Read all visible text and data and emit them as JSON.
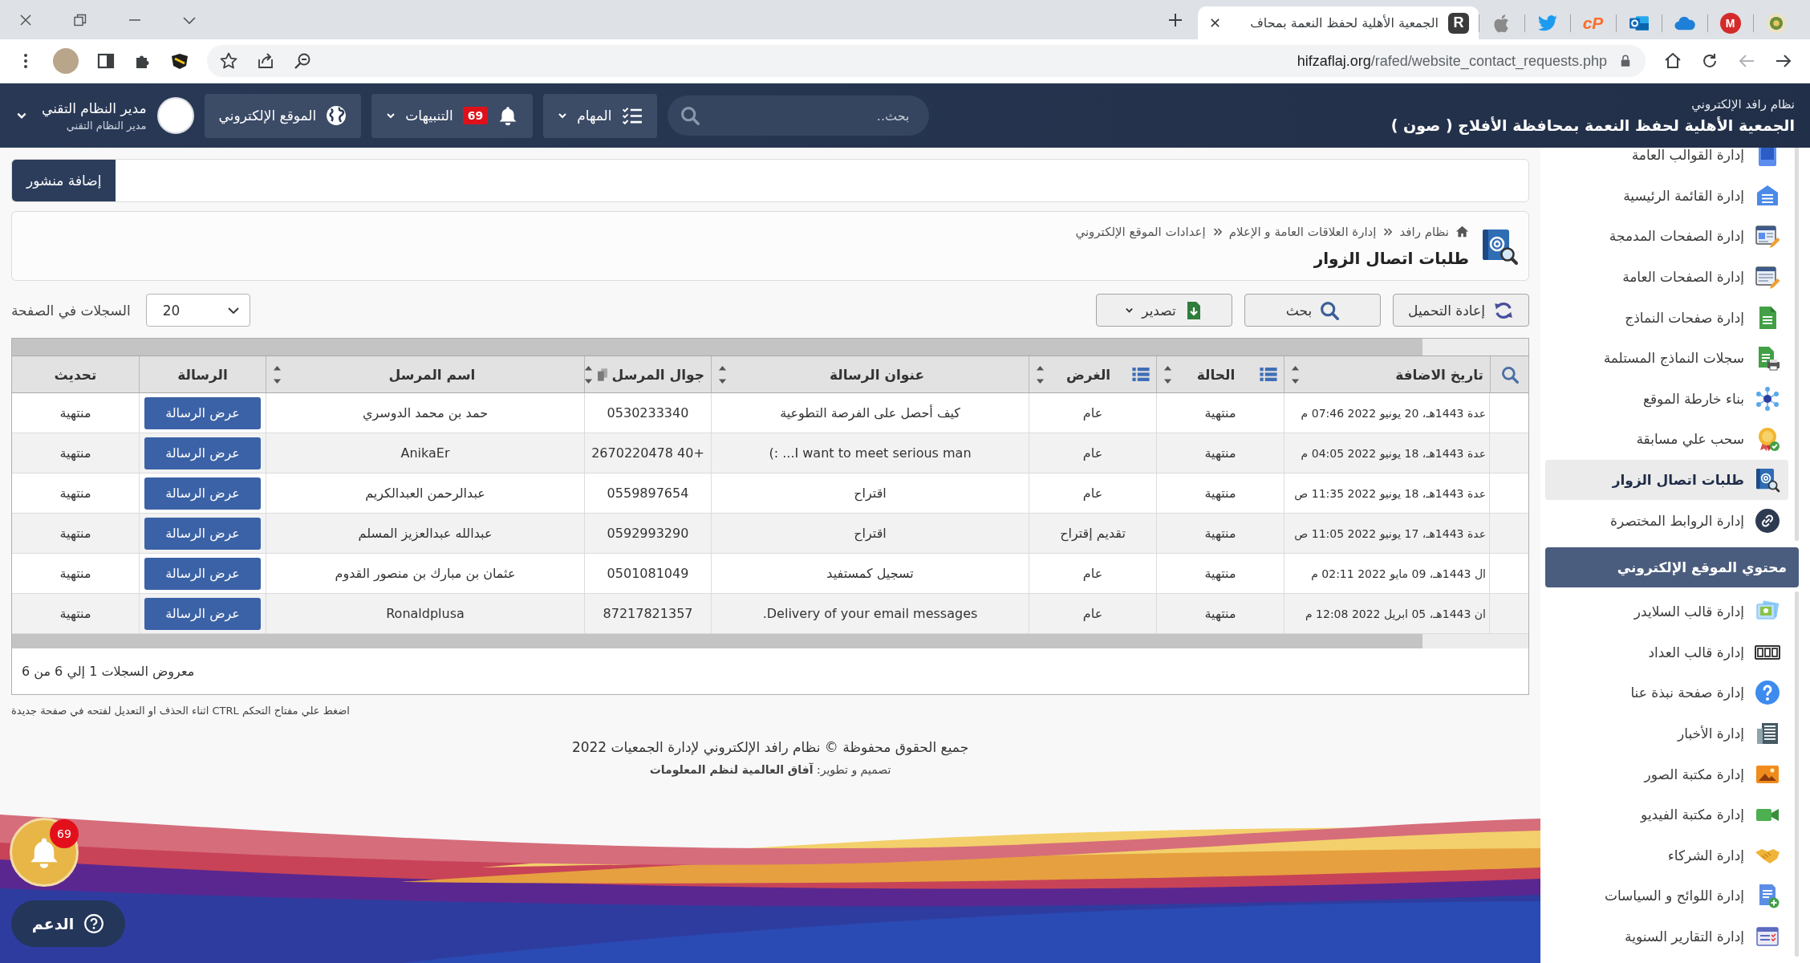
{
  "browser": {
    "tabs": [
      {
        "selected": false
      },
      {
        "selected": false,
        "text": "M"
      },
      {
        "selected": false
      },
      {
        "selected": false
      },
      {
        "selected": false,
        "text": "cP"
      },
      {
        "selected": false
      },
      {
        "selected": false
      },
      {
        "selected": true,
        "favicon": "R",
        "title": "الجمعية الأهلية لحفظ النعمة بمحاف"
      }
    ],
    "url": {
      "host": "hifzaflaj.org",
      "path": "/rafed/website_contact_requests.php"
    }
  },
  "header": {
    "system_name": "نظام رافد الإلكتروني",
    "org_name": "الجمعية الأهلية لحفظ النعمة بمحافظة الأفلاج ( صون )",
    "search": {
      "placeholder": "بحث.."
    },
    "menus": [
      {
        "kind": "tasks",
        "label": "المهام"
      },
      {
        "kind": "notifications",
        "label": "التنبيهات",
        "badge": "69"
      },
      {
        "kind": "website",
        "label": "الموقع الإلكتروني"
      }
    ],
    "user": {
      "name": "مدير النظام التقني",
      "role": "مدير النظام التقني"
    }
  },
  "sidebar": {
    "groups": [
      {
        "items": [
          {
            "label": "إدارة القوالب العامة",
            "selected": false
          },
          {
            "label": "إدارة القائمة الرئيسية",
            "selected": false
          },
          {
            "label": "إدارة الصفحات المدمجة",
            "selected": false
          },
          {
            "label": "إدارة الصفحات العامة",
            "selected": false
          },
          {
            "label": "إدارة صفحات النماذج",
            "selected": false
          },
          {
            "label": "سجلات النماذج المستلمة",
            "selected": false
          },
          {
            "label": "بناء خارطة الموقع",
            "selected": false
          },
          {
            "label": "سحب علي مسابقة",
            "selected": false
          },
          {
            "label": "طلبات اتصال الزوار",
            "selected": true
          },
          {
            "label": "إدارة الروابط المختصرة",
            "selected": false
          }
        ]
      },
      {
        "heading": "محتوي الموقع الإلكتروني",
        "items": [
          {
            "label": "إدارة قالب السلايدر",
            "selected": false
          },
          {
            "label": "إدارة قالب العداد",
            "selected": false
          },
          {
            "label": "إدارة صفحة نبذة عنا",
            "selected": false
          },
          {
            "label": "إدارة الأخبار",
            "selected": false
          },
          {
            "label": "إدارة مكتبة الصور",
            "selected": false
          },
          {
            "label": "إدارة مكتبة الفيديو",
            "selected": false
          },
          {
            "label": "إدارة الشركاء",
            "selected": false
          },
          {
            "label": "إدارة اللوائح و السياسات",
            "selected": false
          },
          {
            "label": "إدارة التقارير السنوية",
            "selected": false
          }
        ]
      }
    ]
  },
  "post_bar": {
    "button": "إضافة منشور"
  },
  "page": {
    "breadcrumb": [
      "نظام رافد",
      "إدارة العلاقات العامة و الإعلام",
      "إعدادات الموقع الإلكتروني"
    ],
    "title": "طلبات اتصال الزوار"
  },
  "actions": [
    {
      "kind": "reload",
      "label": "إعادة التحميل"
    },
    {
      "kind": "search",
      "label": "بحث"
    },
    {
      "kind": "export",
      "label": "تصدير"
    }
  ],
  "page_size": {
    "label": "السجلات في الصفحة",
    "value": "20"
  },
  "table": {
    "columns": [
      {
        "label": "تاريخ الاضافة",
        "kind": "date",
        "sortable": true,
        "filterable": false
      },
      {
        "label": "الحالة",
        "kind": "text",
        "sortable": true,
        "filterable": true
      },
      {
        "label": "الغرض",
        "kind": "text",
        "sortable": true,
        "filterable": true
      },
      {
        "label": "عنوان الرسالة",
        "kind": "text",
        "sortable": true,
        "filterable": false
      },
      {
        "label": "جوال المرسل",
        "kind": "phone",
        "sortable": true,
        "filterable": false
      },
      {
        "label": "اسم المرسل",
        "kind": "text",
        "sortable": true,
        "filterable": false
      },
      {
        "label": "الرسالة",
        "kind": "button",
        "sortable": false,
        "filterable": false
      },
      {
        "label": "تحديث",
        "kind": "text",
        "sortable": false,
        "filterable": false
      }
    ],
    "rows": [
      {
        "cells": [
          "عدة 1443هـ، 20 يونيو 2022 07:46 م",
          "منتهية",
          "عام",
          "كيف أحصل على الفرصة التطوعية",
          "0530233340",
          "حمد بن محمد الدوسري",
          "عرض الرسالة",
          "منتهية"
        ]
      },
      {
        "cells": [
          "عدة 1443هـ، 18 يونيو 2022 04:05 م",
          "منتهية",
          "عام",
          "I want to meet serious man... :)",
          "+40 2670220478",
          "AnikaEr",
          "عرض الرسالة",
          "منتهية"
        ]
      },
      {
        "cells": [
          "عدة 1443هـ، 18 يونيو 2022 11:35 ص",
          "منتهية",
          "عام",
          "اقتراح",
          "0559897654",
          "عبدالرحمن العبدالكريم",
          "عرض الرسالة",
          "منتهية"
        ]
      },
      {
        "cells": [
          "عدة 1443هـ، 17 يونيو 2022 11:05 ص",
          "منتهية",
          "تقديم إقتراح",
          "اقتراح",
          "0592993290",
          "عبدالله عبدالعزيز المسلم",
          "عرض الرسالة",
          "منتهية"
        ]
      },
      {
        "cells": [
          "ال 1443هـ، 09 مايو 2022 02:11 م",
          "منتهية",
          "عام",
          "تسجيل كمستفيد",
          "0501081049",
          "عثمان بن مبارك بن منصور القدوم",
          "عرض الرسالة",
          "منتهية"
        ]
      },
      {
        "cells": [
          "ان 1443هـ، 05 ابريل 2022 12:08 م",
          "منتهية",
          "عام",
          "Delivery of your email messages.",
          "87217821357",
          "Ronaldplusa",
          "عرض الرسالة",
          "منتهية"
        ]
      }
    ],
    "summary": "معروض السجلات 1 إلي 6 من 6"
  },
  "hint": "اضغط علي مفتاح التحكم CTRL اثناء الحذف او التعديل لفتحه في صفحة جديدة",
  "footer": {
    "copyright": "جميع الحقوق محفوظة © نظام رافد الإلكتروني لإدارة الجمعيات 2022",
    "credit": "تصميم و تطوير: **آفاق العالمية لنظم المعلومات**"
  },
  "floating": {
    "badge": "69",
    "support": "الدعم"
  }
}
